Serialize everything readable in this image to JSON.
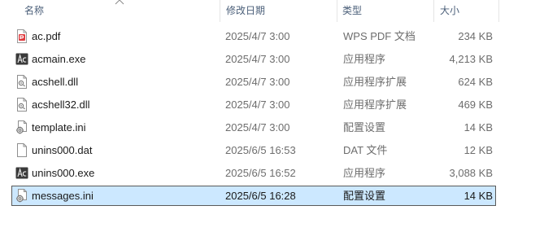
{
  "columns": {
    "name": "名称",
    "modified": "修改日期",
    "type": "类型",
    "size": "大小"
  },
  "files": [
    {
      "name": "ac.pdf",
      "modified": "2025/4/7 3:00",
      "type": "WPS PDF 文档",
      "size": "234 KB",
      "icon": "pdf-file-icon"
    },
    {
      "name": "acmain.exe",
      "modified": "2025/4/7 3:00",
      "type": "应用程序",
      "size": "4,213 KB",
      "icon": "acrobat-exe-icon"
    },
    {
      "name": "acshell.dll",
      "modified": "2025/4/7 3:00",
      "type": "应用程序扩展",
      "size": "624 KB",
      "icon": "dll-file-icon"
    },
    {
      "name": "acshell32.dll",
      "modified": "2025/4/7 3:00",
      "type": "应用程序扩展",
      "size": "469 KB",
      "icon": "dll-file-icon"
    },
    {
      "name": "template.ini",
      "modified": "2025/4/7 3:00",
      "type": "配置设置",
      "size": "14 KB",
      "icon": "settings-file-icon"
    },
    {
      "name": "unins000.dat",
      "modified": "2025/6/5 16:53",
      "type": "DAT 文件",
      "size": "12 KB",
      "icon": "blank-file-icon"
    },
    {
      "name": "unins000.exe",
      "modified": "2025/6/5 16:52",
      "type": "应用程序",
      "size": "3,088 KB",
      "icon": "acrobat-exe-icon"
    },
    {
      "name": "messages.ini",
      "modified": "2025/6/5 16:28",
      "type": "配置设置",
      "size": "14 KB",
      "icon": "settings-file-icon",
      "selected": true
    }
  ],
  "colors": {
    "selection_bg": "#cce8ff",
    "header_text": "#4c607a",
    "pdf_red": "#e03a3e",
    "exe_dark": "#3a3a3a"
  }
}
